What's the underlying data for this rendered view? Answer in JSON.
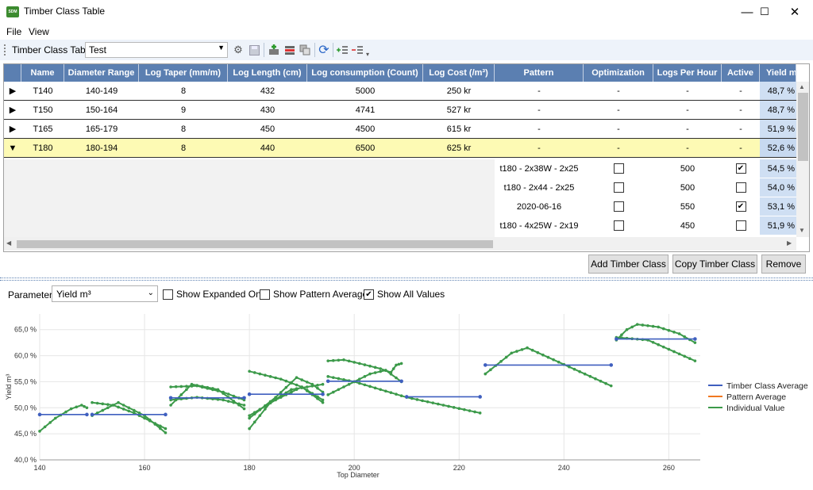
{
  "window": {
    "title": "Timber Class Table",
    "app_icon_text": "SDM",
    "minimize": "—",
    "maximize": "☐",
    "close": "✕"
  },
  "menu": [
    "File",
    "View"
  ],
  "toolbar": {
    "label": "Timber Class Table",
    "combo_value": "Test"
  },
  "grid": {
    "columns": [
      "Name",
      "Diameter Range",
      "Log Taper (mm/m)",
      "Log Length (cm)",
      "Log consumption (Count)",
      "Log Cost (/m³)",
      "Pattern",
      "Optimization",
      "Logs Per Hour",
      "Active",
      "Yield m"
    ],
    "rows": [
      {
        "name": "T140",
        "diameter": "140-149",
        "taper": "8",
        "length": "432",
        "consumption": "5000",
        "cost": "250 kr",
        "pattern": "-",
        "optimization": "-",
        "logs_per_hour": "-",
        "active": "-",
        "yield": "48,7 %",
        "expanded": false
      },
      {
        "name": "T150",
        "diameter": "150-164",
        "taper": "9",
        "length": "430",
        "consumption": "4741",
        "cost": "527 kr",
        "pattern": "-",
        "optimization": "-",
        "logs_per_hour": "-",
        "active": "-",
        "yield": "48,7 %",
        "expanded": false
      },
      {
        "name": "T165",
        "diameter": "165-179",
        "taper": "8",
        "length": "450",
        "consumption": "4500",
        "cost": "615 kr",
        "pattern": "-",
        "optimization": "-",
        "logs_per_hour": "-",
        "active": "-",
        "yield": "51,9 %",
        "expanded": false
      },
      {
        "name": "T180",
        "diameter": "180-194",
        "taper": "8",
        "length": "440",
        "consumption": "6500",
        "cost": "625 kr",
        "pattern": "-",
        "optimization": "-",
        "logs_per_hour": "-",
        "active": "-",
        "yield": "52,6 %",
        "expanded": true
      }
    ],
    "child_rows": [
      {
        "pattern": "t180 - 2x38W - 2x25",
        "optimization": false,
        "logs_per_hour": "500",
        "active": true,
        "yield": "54,5 %"
      },
      {
        "pattern": "t180 - 2x44 - 2x25",
        "optimization": false,
        "logs_per_hour": "500",
        "active": false,
        "yield": "54,0 %"
      },
      {
        "pattern": "2020-06-16",
        "optimization": false,
        "logs_per_hour": "550",
        "active": true,
        "yield": "53,1 %"
      },
      {
        "pattern": "t180 - 4x25W - 2x19",
        "optimization": false,
        "logs_per_hour": "450",
        "active": false,
        "yield": "51,9 %"
      }
    ]
  },
  "buttons": {
    "add": "Add Timber Class",
    "copy": "Copy Timber Class",
    "remove": "Remove"
  },
  "controls": {
    "parameter_label": "Parameter:",
    "parameter_value": "Yield m³",
    "show_expanded_only": "Show Expanded Only",
    "show_expanded_only_checked": false,
    "show_pattern_averages": "Show Pattern Averages",
    "show_pattern_averages_checked": false,
    "show_all_values": "Show All Values",
    "show_all_values_checked": true
  },
  "chart_data": {
    "type": "line",
    "xlabel": "Top Diameter",
    "ylabel": "Yield m³",
    "xlim": [
      140,
      266
    ],
    "ylim": [
      40,
      68
    ],
    "x_ticks": [
      140,
      160,
      180,
      200,
      220,
      240,
      260
    ],
    "y_ticks": [
      40,
      45,
      50,
      55,
      60,
      65
    ],
    "y_tick_labels": [
      "40,0 %",
      "45,0 %",
      "50,0 %",
      "55,0 %",
      "60,0 %",
      "65,0 %"
    ],
    "grid": true,
    "legend": {
      "position": "right",
      "entries": [
        "Timber Class Average",
        "Pattern Average",
        "Individual Value"
      ]
    },
    "colors": {
      "average": "#3f5fbf",
      "pattern": "#f07820",
      "individual": "#3c9a4a"
    },
    "series": [
      {
        "name": "Timber Class Average",
        "segments": [
          [
            [
              140,
              48.7
            ],
            [
              149,
              48.7
            ]
          ],
          [
            [
              150,
              48.7
            ],
            [
              164,
              48.7
            ]
          ],
          [
            [
              165,
              51.9
            ],
            [
              179,
              51.9
            ]
          ],
          [
            [
              180,
              52.6
            ],
            [
              194,
              52.6
            ]
          ],
          [
            [
              195,
              55.1
            ],
            [
              209,
              55.1
            ]
          ],
          [
            [
              210,
              52.1
            ],
            [
              224,
              52.1
            ]
          ],
          [
            [
              225,
              58.2
            ],
            [
              249,
              58.2
            ]
          ],
          [
            [
              250,
              63.2
            ],
            [
              265,
              63.2
            ]
          ]
        ]
      },
      {
        "name": "Pattern Average",
        "segments": []
      },
      {
        "name": "Individual Value",
        "segments": [
          [
            [
              140,
              45.5
            ],
            [
              143,
              48
            ],
            [
              146,
              49.8
            ],
            [
              148,
              50.5
            ],
            [
              149,
              50
            ]
          ],
          [
            [
              150,
              51
            ],
            [
              154,
              50.5
            ],
            [
              158,
              49
            ],
            [
              164,
              46
            ]
          ],
          [
            [
              150,
              48.5
            ],
            [
              155,
              51
            ],
            [
              160,
              48.5
            ],
            [
              164,
              45.2
            ]
          ],
          [
            [
              165,
              54
            ],
            [
              170,
              54.2
            ],
            [
              175,
              53
            ],
            [
              179,
              51.5
            ]
          ],
          [
            [
              165,
              50.5
            ],
            [
              169,
              54.5
            ],
            [
              174,
              53.5
            ],
            [
              179,
              49.8
            ]
          ],
          [
            [
              165,
              51.5
            ],
            [
              170,
              52
            ],
            [
              175,
              51.5
            ],
            [
              179,
              50.5
            ]
          ],
          [
            [
              180,
              57
            ],
            [
              186,
              55.5
            ],
            [
              190,
              54
            ],
            [
              194,
              51.5
            ]
          ],
          [
            [
              180,
              48
            ],
            [
              185,
              52
            ],
            [
              189,
              55.8
            ],
            [
              192,
              54.5
            ],
            [
              194,
              53
            ]
          ],
          [
            [
              180,
              46
            ],
            [
              184,
              51
            ],
            [
              188,
              53.5
            ],
            [
              194,
              54.5
            ]
          ],
          [
            [
              180,
              48.5
            ],
            [
              185,
              51.5
            ],
            [
              190,
              54
            ],
            [
              194,
              51
            ]
          ],
          [
            [
              195,
              59
            ],
            [
              198,
              59.2
            ],
            [
              201,
              58.5
            ],
            [
              205,
              57.5
            ],
            [
              207,
              56.8
            ],
            [
              208,
              58.2
            ],
            [
              209,
              58.5
            ]
          ],
          [
            [
              195,
              52.5
            ],
            [
              199,
              54.5
            ],
            [
              203,
              56.5
            ],
            [
              206,
              57.2
            ],
            [
              209,
              55
            ]
          ],
          [
            [
              195,
              56
            ],
            [
              200,
              55
            ],
            [
              210,
              52
            ],
            [
              224,
              49
            ]
          ],
          [
            [
              225,
              56.5
            ],
            [
              230,
              60.5
            ],
            [
              233,
              61.5
            ],
            [
              249,
              54.2
            ]
          ],
          [
            [
              250,
              63
            ],
            [
              252,
              65
            ],
            [
              254,
              66
            ],
            [
              258,
              65.5
            ],
            [
              262,
              64.2
            ],
            [
              265,
              62.5
            ]
          ],
          [
            [
              250,
              63.5
            ],
            [
              256,
              63
            ],
            [
              265,
              59
            ]
          ]
        ]
      }
    ]
  }
}
